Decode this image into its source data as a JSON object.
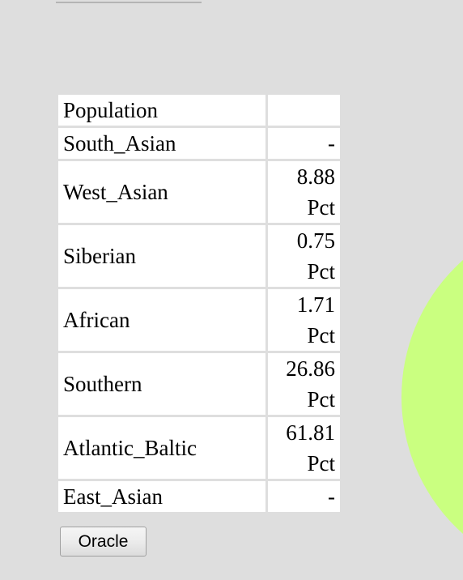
{
  "page": {
    "background_color": "#dedede",
    "decoration": {
      "shape_name": "green-circle",
      "color": "#caff80"
    }
  },
  "table": {
    "header": {
      "label": "Population",
      "value": ""
    },
    "rows": [
      {
        "label": "South_Asian",
        "value": "-",
        "unit": "",
        "lines": 1
      },
      {
        "label": "West_Asian",
        "value": "8.88",
        "unit": "Pct",
        "lines": 2
      },
      {
        "label": "Siberian",
        "value": "0.75",
        "unit": "Pct",
        "lines": 2
      },
      {
        "label": "African",
        "value": "1.71",
        "unit": "Pct",
        "lines": 2
      },
      {
        "label": "Southern",
        "value": "26.86",
        "unit": "Pct",
        "lines": 2
      },
      {
        "label": "Atlantic_Baltic",
        "value": "61.81",
        "unit": "Pct",
        "lines": 2
      },
      {
        "label": "East_Asian",
        "value": "-",
        "unit": "",
        "lines": 1
      }
    ]
  },
  "actions": {
    "oracle_label": "Oracle"
  }
}
